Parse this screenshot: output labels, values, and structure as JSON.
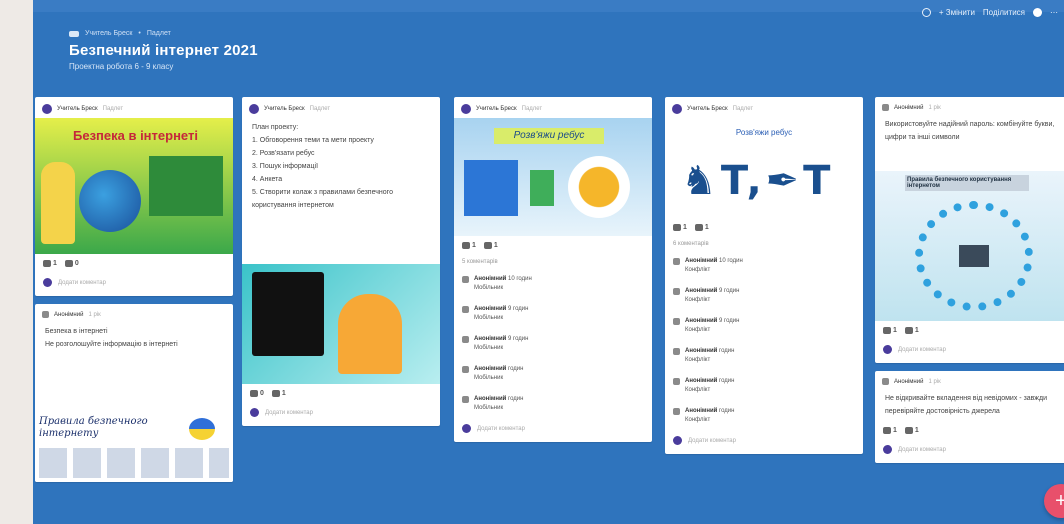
{
  "header": {
    "crumbs": [
      "Учитель Бреск",
      "•",
      "Падлет"
    ],
    "title": "Безпечний інтернет 2021",
    "subtitle": "Проектна робота 6 - 9 класу"
  },
  "topbar": {
    "share": "Поділитися",
    "remake": "+ Змінити"
  },
  "columns": [
    {
      "cards": [
        {
          "author": "Учитель Бреск",
          "time": "Падлет",
          "image_text": "Безпека в інтернеті",
          "likes": "1",
          "comments": "0",
          "add_comment": "Додати коментар"
        },
        {
          "author": "Анонімний",
          "time": "1 рік",
          "text": "Безпека в інтернеті\nНе розголошуйте інформацію в інтернеті",
          "image_text": "Правила безпечного інтернету"
        }
      ]
    },
    {
      "cards": [
        {
          "author": "Учитель Бреск",
          "time": "Падлет",
          "text": "План проекту:\n1. Обговорення теми та мети проекту\n2. Розв'язати ребус\n3. Пошук інформації\n4. Анкета\n5. Створити колаж з правилами безпечного користування інтернетом",
          "likes": "0",
          "comments": "1",
          "add_comment": "Додати коментар"
        }
      ]
    },
    {
      "cards": [
        {
          "author": "Учитель Бреск",
          "time": "Падлет",
          "image_text": "Розв'яжи ребус",
          "likes": "1",
          "comments": "1",
          "comments_label": "5 коментарів",
          "comment_list": [
            {
              "author": "Анонімний",
              "time": "10 годин",
              "text": "Мобільник"
            },
            {
              "author": "Анонімний",
              "time": "9 годин",
              "text": "Мобільник"
            },
            {
              "author": "Анонімний",
              "time": "9 годин",
              "text": "Мобільник"
            },
            {
              "author": "Анонімний",
              "time": "годин",
              "text": "Мобільник"
            },
            {
              "author": "Анонімний",
              "time": "годин",
              "text": "Мобільник"
            }
          ],
          "add_comment": "Додати коментар"
        }
      ]
    },
    {
      "cards": [
        {
          "author": "Учитель Бреск",
          "time": "Падлет",
          "image_text": "Розв'яжи ребус",
          "likes": "1",
          "comments": "1",
          "comments_label": "6 коментарів",
          "comment_list": [
            {
              "author": "Анонімний",
              "time": "10 годин",
              "text": "Конфлікт"
            },
            {
              "author": "Анонімний",
              "time": "9 годин",
              "text": "Конфлікт"
            },
            {
              "author": "Анонімний",
              "time": "9 годин",
              "text": "Конфлікт"
            },
            {
              "author": "Анонімний",
              "time": "годин",
              "text": "Конфлікт"
            },
            {
              "author": "Анонімний",
              "time": "годин",
              "text": "Конфлікт"
            },
            {
              "author": "Анонімний",
              "time": "годин",
              "text": "Конфлікт"
            }
          ],
          "add_comment": "Додати коментар"
        }
      ]
    },
    {
      "cards": [
        {
          "author": "Анонімний",
          "time": "1 рік",
          "text": "Використовуйте надійний пароль: комбінуйте букви, цифри та інші символи",
          "image_text": "Правила безпечного користування інтернетом",
          "likes": "1",
          "comments": "1",
          "add_comment": "Додати коментар"
        },
        {
          "author": "Анонімний",
          "time": "1 рік",
          "text": "Не відкривайте вкладення від невідомих - завжди перевіряйте достовірність джерела",
          "likes": "1",
          "comments": "1",
          "add_comment": "Додати коментар"
        }
      ]
    }
  ],
  "colors": {
    "board": "#2f74bd",
    "card": "#ffffff",
    "fab": "#e8506b"
  },
  "fab_icon": "plus-icon"
}
